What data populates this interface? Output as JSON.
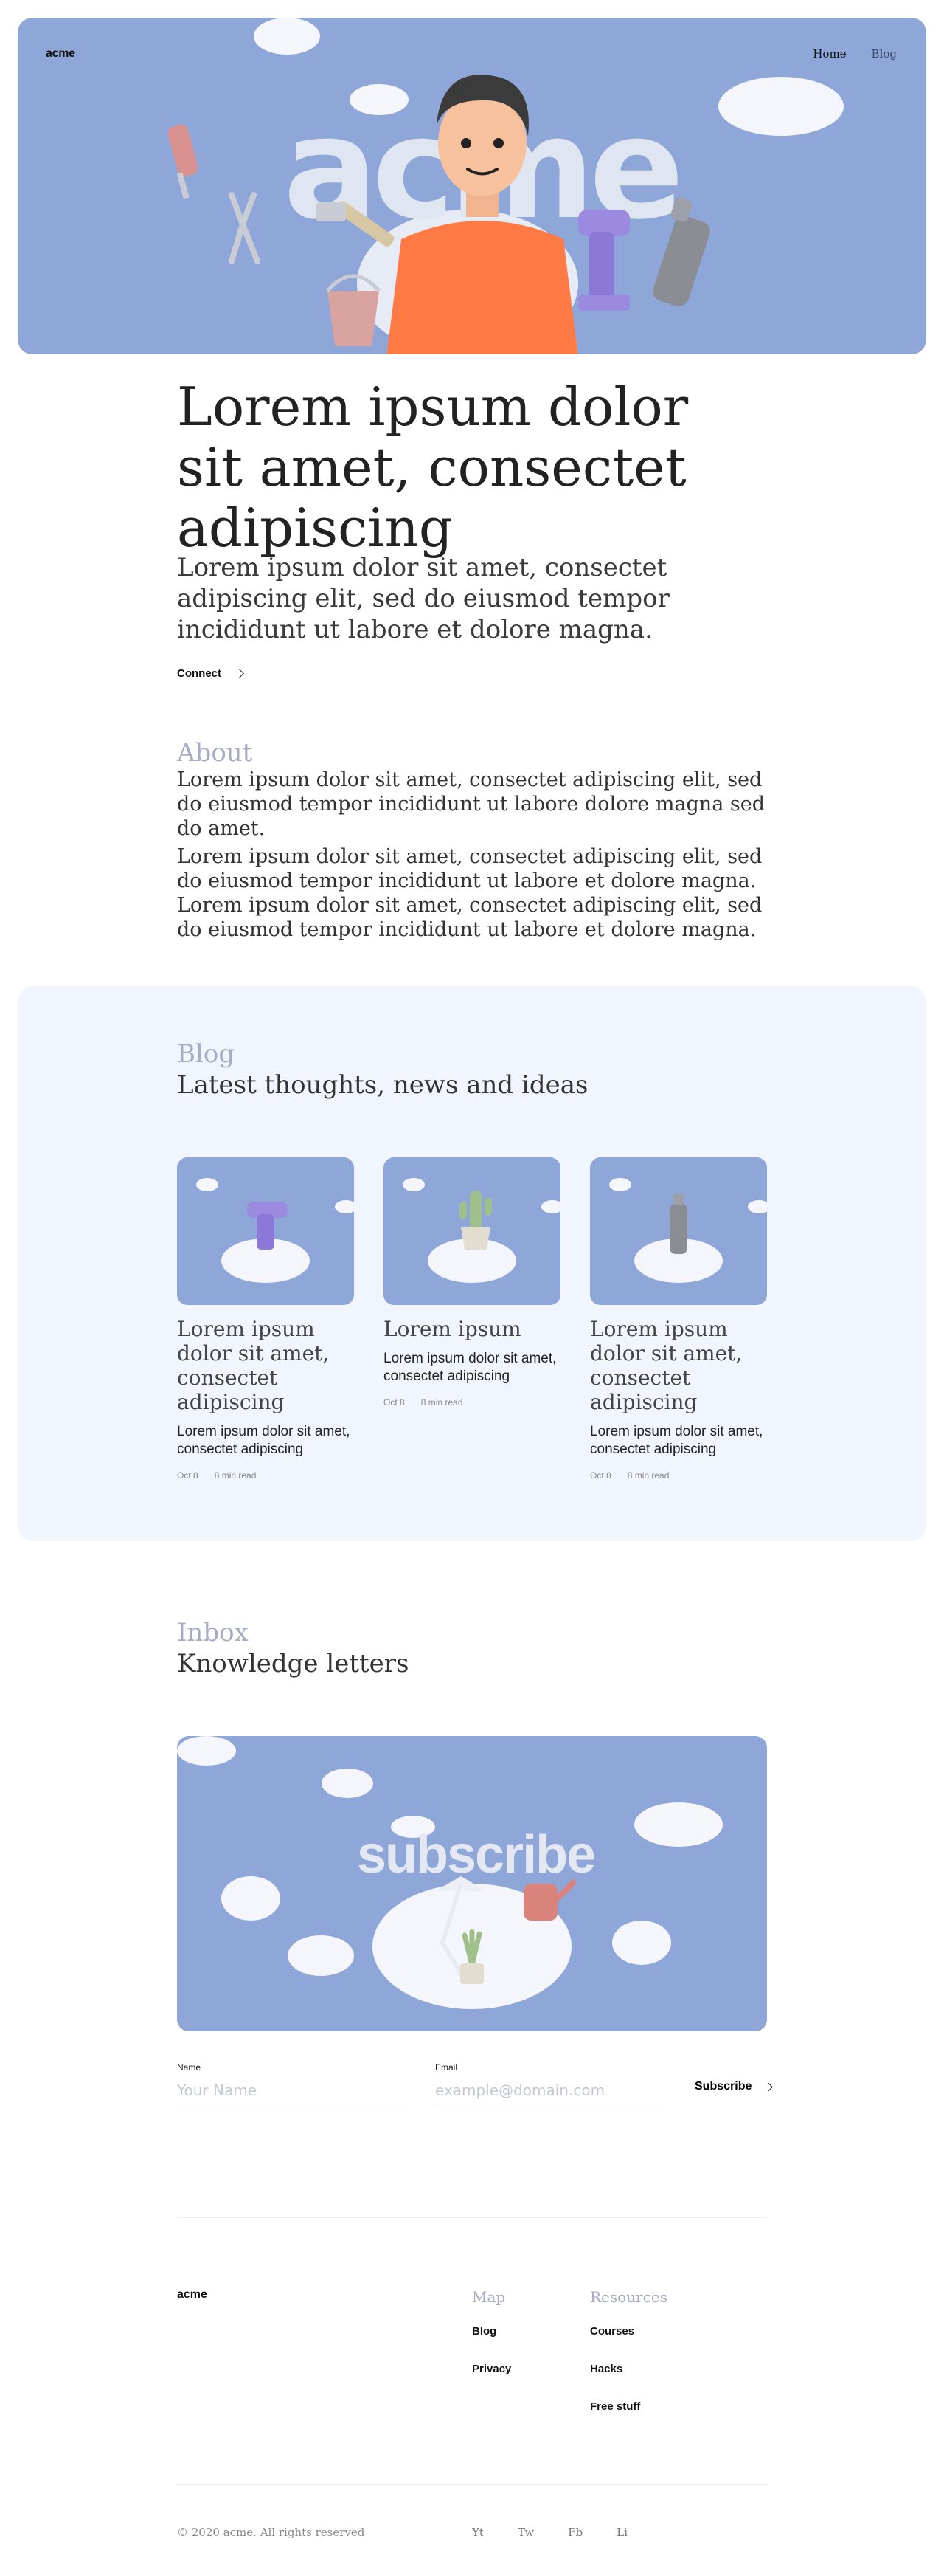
{
  "header": {
    "logo": "acme",
    "nav": [
      {
        "label": "Home"
      },
      {
        "label": "Blog"
      }
    ],
    "hero_word": "acme"
  },
  "intro": {
    "headline": "Lorem ipsum dolor sit amet, consectet  adipiscing",
    "paragraph": "Lorem ipsum dolor sit amet, consectet  adipiscing elit, sed do eiusmod tempor incididunt ut labore et dolore magna.",
    "cta_label": "Connect"
  },
  "about": {
    "title": "About",
    "p1": "Lorem ipsum dolor sit amet, consectet  adipiscing elit, sed do eiusmod tempor incididunt ut labore dolore magna sed do amet.",
    "p2": "Lorem ipsum dolor sit amet, consectet  adipiscing elit, sed do eiusmod tempor incididunt ut labore et dolore magna. Lorem ipsum dolor sit amet, consectet  adipiscing elit, sed do eiusmod tempor incididunt ut labore et dolore magna."
  },
  "blog": {
    "title": "Blog",
    "subtitle": "Latest thoughts, news and ideas",
    "cards": [
      {
        "title": "Lorem ipsum dolor sit amet, consectet  adipiscing",
        "desc": "Lorem ipsum dolor sit amet, consectet  adipiscing",
        "date": "Oct 8",
        "read": "8 min read",
        "icon": "drill-icon"
      },
      {
        "title": "Lorem ipsum",
        "desc": "Lorem ipsum dolor sit amet, consectet  adipiscing",
        "date": "Oct 8",
        "read": "8 min read",
        "icon": "cactus-icon"
      },
      {
        "title": "Lorem ipsum dolor sit amet, consectet  adipiscing",
        "desc": "Lorem ipsum dolor sit amet, consectet  adipiscing",
        "date": "Oct 8",
        "read": "8 min read",
        "icon": "bottle-icon"
      }
    ]
  },
  "inbox": {
    "title": "Inbox",
    "subtitle": "Knowledge letters",
    "image_word": "subscribe",
    "name_label": "Name",
    "name_placeholder": "Your Name",
    "email_label": "Email",
    "email_placeholder": "example@domain.com",
    "button_label": "Subscribe"
  },
  "footer": {
    "logo": "acme",
    "map_title": "Map",
    "map_links": [
      "Blog",
      "Privacy"
    ],
    "resources_title": "Resources",
    "resources_links": [
      "Courses",
      "Hacks",
      "Free stuff"
    ],
    "copyright": "© 2020 acme. All rights reserved",
    "social": [
      "Yt",
      "Tw",
      "Fb",
      "Li"
    ]
  },
  "colors": {
    "hero_bg": "#8ea6d8",
    "blog_bg": "#f1f5fd",
    "muted_title": "#a6acc4"
  }
}
